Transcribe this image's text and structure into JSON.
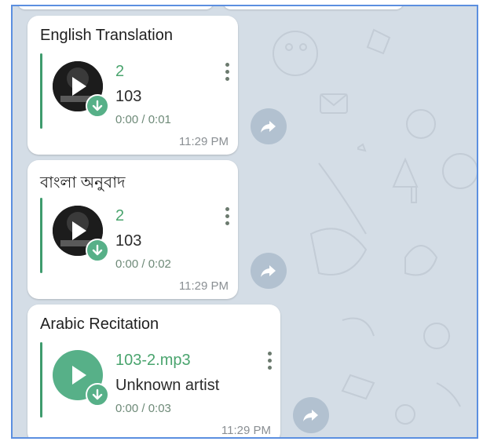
{
  "messages": [
    {
      "title": "English Translation",
      "track_title": "2",
      "track_sub": "103",
      "duration": "0:00 / 0:01",
      "time": "11:29 PM",
      "cover": "album-art"
    },
    {
      "title": "বাংলা অনুবাদ",
      "track_title": "2",
      "track_sub": "103",
      "duration": "0:00 / 0:02",
      "time": "11:29 PM",
      "cover": "album-art"
    },
    {
      "title": "Arabic Recitation",
      "track_title": "103-2.mp3",
      "track_sub": "Unknown artist",
      "duration": "0:00 / 0:03",
      "time": "11:29 PM",
      "cover": "plain-green"
    }
  ],
  "icons": {
    "play": "play-icon",
    "download": "download-arrow-icon",
    "more": "more-vertical-icon",
    "share": "forward-share-icon"
  },
  "colors": {
    "accent": "#3f9c6e",
    "title_green": "#4aa46e",
    "badge": "#57b088",
    "wallpaper": "#d4dde6"
  }
}
